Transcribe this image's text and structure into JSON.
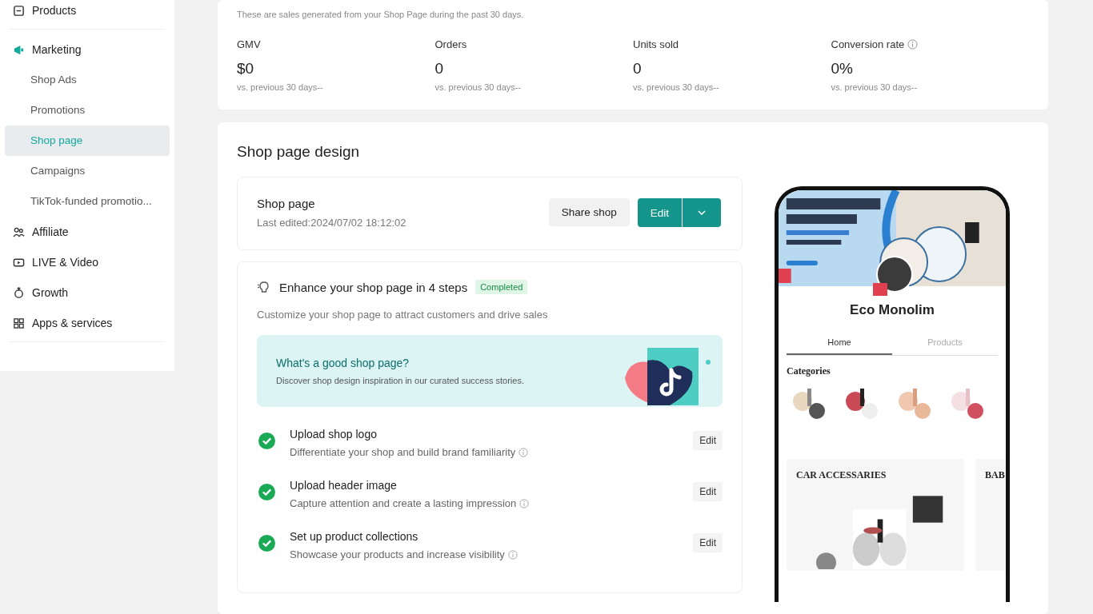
{
  "sidebar": {
    "items": [
      {
        "label": "Products"
      },
      {
        "label": "Marketing",
        "children": [
          {
            "label": "Shop Ads",
            "selected": false
          },
          {
            "label": "Promotions",
            "selected": false
          },
          {
            "label": "Shop page",
            "selected": true
          },
          {
            "label": "Campaigns",
            "selected": false
          },
          {
            "label": "TikTok-funded promotio...",
            "selected": false
          }
        ]
      },
      {
        "label": "Affiliate"
      },
      {
        "label": "LIVE & Video"
      },
      {
        "label": "Growth"
      },
      {
        "label": "Apps & services"
      }
    ]
  },
  "performance": {
    "subtitle": "These are sales generated from your Shop Page during the past 30 days.",
    "metrics": [
      {
        "label": "GMV",
        "value": "$0",
        "comparison": "vs. previous 30 days--",
        "info": false
      },
      {
        "label": "Orders",
        "value": "0",
        "comparison": "vs. previous 30 days--",
        "info": false
      },
      {
        "label": "Units sold",
        "value": "0",
        "comparison": "vs. previous 30 days--",
        "info": false
      },
      {
        "label": "Conversion rate",
        "value": "0%",
        "comparison": "vs. previous 30 days--",
        "info": true
      }
    ]
  },
  "design": {
    "title": "Shop page design",
    "shop_card": {
      "title": "Shop page",
      "last_edited": "Last edited:2024/07/02 18:12:02",
      "share_button": "Share shop",
      "edit_button": "Edit"
    },
    "steps_card": {
      "title": "Enhance your shop page in 4 steps",
      "badge": "Completed",
      "subtitle": "Customize your shop page to attract customers and drive sales",
      "banner": {
        "title": "What's a good shop page?",
        "text": "Discover shop design inspiration in our curated success stories."
      },
      "steps": [
        {
          "title": "Upload shop logo",
          "description": "Differentiate your shop and build brand familiarity",
          "done": true,
          "button": "Edit"
        },
        {
          "title": "Upload header image",
          "description": "Capture attention and create a lasting impression",
          "done": true,
          "button": "Edit"
        },
        {
          "title": "Set up product collections",
          "description": "Showcase your products and increase visibility",
          "done": true,
          "button": "Edit"
        }
      ]
    },
    "preview": {
      "shop_name": "Eco Monolim",
      "tabs": [
        {
          "label": "Home",
          "selected": true
        },
        {
          "label": "Products",
          "selected": false
        }
      ],
      "categories_title": "Categories",
      "collections": [
        "CAR ACCESSARIES",
        "BAB"
      ]
    }
  }
}
